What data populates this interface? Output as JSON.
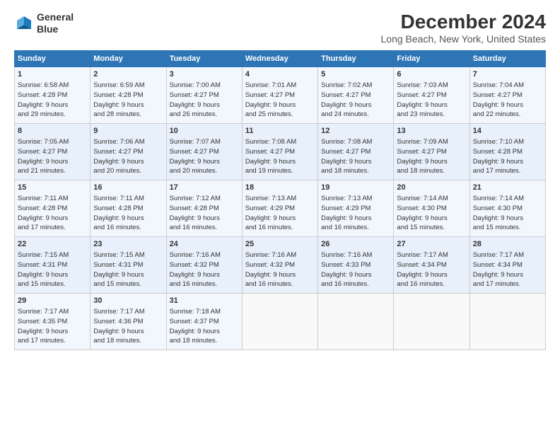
{
  "logo": {
    "line1": "General",
    "line2": "Blue"
  },
  "header": {
    "title": "December 2024",
    "subtitle": "Long Beach, New York, United States"
  },
  "days_of_week": [
    "Sunday",
    "Monday",
    "Tuesday",
    "Wednesday",
    "Thursday",
    "Friday",
    "Saturday"
  ],
  "weeks": [
    [
      {
        "day": "1",
        "text": "Sunrise: 6:58 AM\nSunset: 4:28 PM\nDaylight: 9 hours\nand 29 minutes."
      },
      {
        "day": "2",
        "text": "Sunrise: 6:59 AM\nSunset: 4:28 PM\nDaylight: 9 hours\nand 28 minutes."
      },
      {
        "day": "3",
        "text": "Sunrise: 7:00 AM\nSunset: 4:27 PM\nDaylight: 9 hours\nand 26 minutes."
      },
      {
        "day": "4",
        "text": "Sunrise: 7:01 AM\nSunset: 4:27 PM\nDaylight: 9 hours\nand 25 minutes."
      },
      {
        "day": "5",
        "text": "Sunrise: 7:02 AM\nSunset: 4:27 PM\nDaylight: 9 hours\nand 24 minutes."
      },
      {
        "day": "6",
        "text": "Sunrise: 7:03 AM\nSunset: 4:27 PM\nDaylight: 9 hours\nand 23 minutes."
      },
      {
        "day": "7",
        "text": "Sunrise: 7:04 AM\nSunset: 4:27 PM\nDaylight: 9 hours\nand 22 minutes."
      }
    ],
    [
      {
        "day": "8",
        "text": "Sunrise: 7:05 AM\nSunset: 4:27 PM\nDaylight: 9 hours\nand 21 minutes."
      },
      {
        "day": "9",
        "text": "Sunrise: 7:06 AM\nSunset: 4:27 PM\nDaylight: 9 hours\nand 20 minutes."
      },
      {
        "day": "10",
        "text": "Sunrise: 7:07 AM\nSunset: 4:27 PM\nDaylight: 9 hours\nand 20 minutes."
      },
      {
        "day": "11",
        "text": "Sunrise: 7:08 AM\nSunset: 4:27 PM\nDaylight: 9 hours\nand 19 minutes."
      },
      {
        "day": "12",
        "text": "Sunrise: 7:08 AM\nSunset: 4:27 PM\nDaylight: 9 hours\nand 18 minutes."
      },
      {
        "day": "13",
        "text": "Sunrise: 7:09 AM\nSunset: 4:27 PM\nDaylight: 9 hours\nand 18 minutes."
      },
      {
        "day": "14",
        "text": "Sunrise: 7:10 AM\nSunset: 4:28 PM\nDaylight: 9 hours\nand 17 minutes."
      }
    ],
    [
      {
        "day": "15",
        "text": "Sunrise: 7:11 AM\nSunset: 4:28 PM\nDaylight: 9 hours\nand 17 minutes."
      },
      {
        "day": "16",
        "text": "Sunrise: 7:11 AM\nSunset: 4:28 PM\nDaylight: 9 hours\nand 16 minutes."
      },
      {
        "day": "17",
        "text": "Sunrise: 7:12 AM\nSunset: 4:28 PM\nDaylight: 9 hours\nand 16 minutes."
      },
      {
        "day": "18",
        "text": "Sunrise: 7:13 AM\nSunset: 4:29 PM\nDaylight: 9 hours\nand 16 minutes."
      },
      {
        "day": "19",
        "text": "Sunrise: 7:13 AM\nSunset: 4:29 PM\nDaylight: 9 hours\nand 16 minutes."
      },
      {
        "day": "20",
        "text": "Sunrise: 7:14 AM\nSunset: 4:30 PM\nDaylight: 9 hours\nand 15 minutes."
      },
      {
        "day": "21",
        "text": "Sunrise: 7:14 AM\nSunset: 4:30 PM\nDaylight: 9 hours\nand 15 minutes."
      }
    ],
    [
      {
        "day": "22",
        "text": "Sunrise: 7:15 AM\nSunset: 4:31 PM\nDaylight: 9 hours\nand 15 minutes."
      },
      {
        "day": "23",
        "text": "Sunrise: 7:15 AM\nSunset: 4:31 PM\nDaylight: 9 hours\nand 15 minutes."
      },
      {
        "day": "24",
        "text": "Sunrise: 7:16 AM\nSunset: 4:32 PM\nDaylight: 9 hours\nand 16 minutes."
      },
      {
        "day": "25",
        "text": "Sunrise: 7:16 AM\nSunset: 4:32 PM\nDaylight: 9 hours\nand 16 minutes."
      },
      {
        "day": "26",
        "text": "Sunrise: 7:16 AM\nSunset: 4:33 PM\nDaylight: 9 hours\nand 16 minutes."
      },
      {
        "day": "27",
        "text": "Sunrise: 7:17 AM\nSunset: 4:34 PM\nDaylight: 9 hours\nand 16 minutes."
      },
      {
        "day": "28",
        "text": "Sunrise: 7:17 AM\nSunset: 4:34 PM\nDaylight: 9 hours\nand 17 minutes."
      }
    ],
    [
      {
        "day": "29",
        "text": "Sunrise: 7:17 AM\nSunset: 4:35 PM\nDaylight: 9 hours\nand 17 minutes."
      },
      {
        "day": "30",
        "text": "Sunrise: 7:17 AM\nSunset: 4:36 PM\nDaylight: 9 hours\nand 18 minutes."
      },
      {
        "day": "31",
        "text": "Sunrise: 7:18 AM\nSunset: 4:37 PM\nDaylight: 9 hours\nand 18 minutes."
      },
      {
        "day": "",
        "text": ""
      },
      {
        "day": "",
        "text": ""
      },
      {
        "day": "",
        "text": ""
      },
      {
        "day": "",
        "text": ""
      }
    ]
  ]
}
